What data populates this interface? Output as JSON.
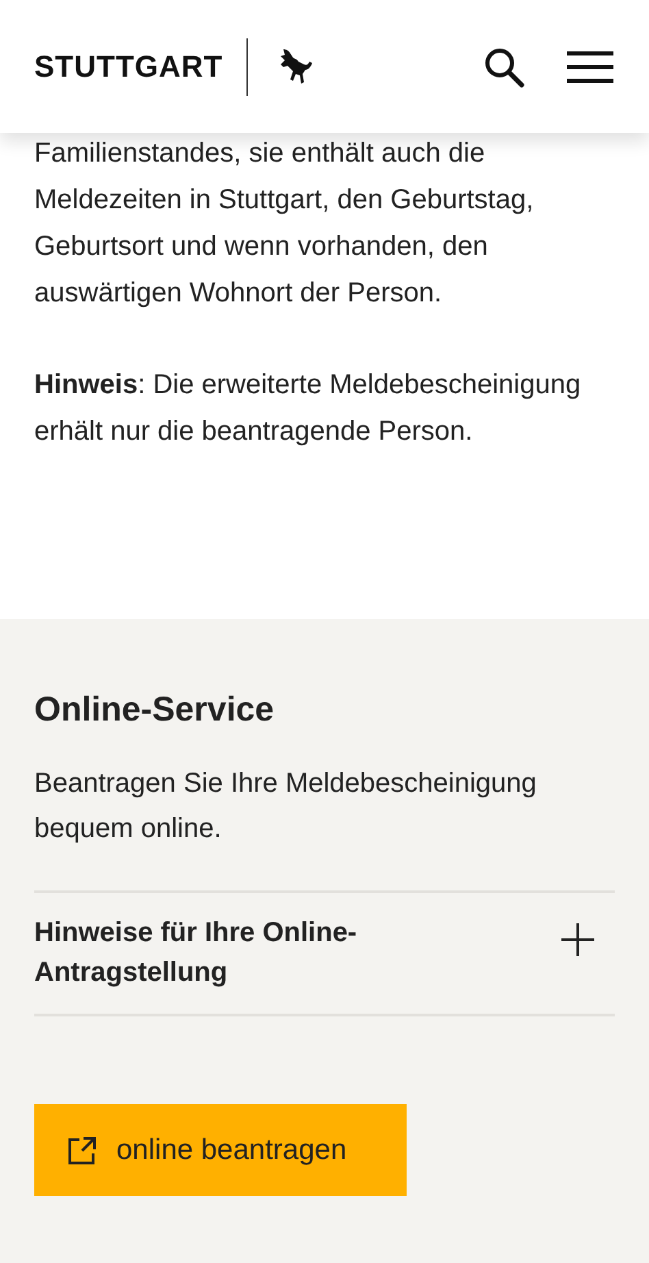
{
  "header": {
    "logo": "STUTTGART"
  },
  "intro": {
    "paragraphs": [
      "Familienstandes, sie enthält auch die Meldezeiten in Stuttgart, den Geburtstag, Geburtsort und wenn vorhanden, den auswärtigen Wohnort der Person.",
      "**Hinweis**: Die erweiterte Meldebescheinigung erhält nur die beantragende Person."
    ]
  },
  "online_service": {
    "title": "Online-Service",
    "text": "Beantragen Sie Ihre Meldebescheinigung bequem online.",
    "accordion": [
      {
        "title": "Hinweise für Ihre Online-Antragstellung",
        "expanded": false
      }
    ],
    "button": "online beantragen"
  }
}
